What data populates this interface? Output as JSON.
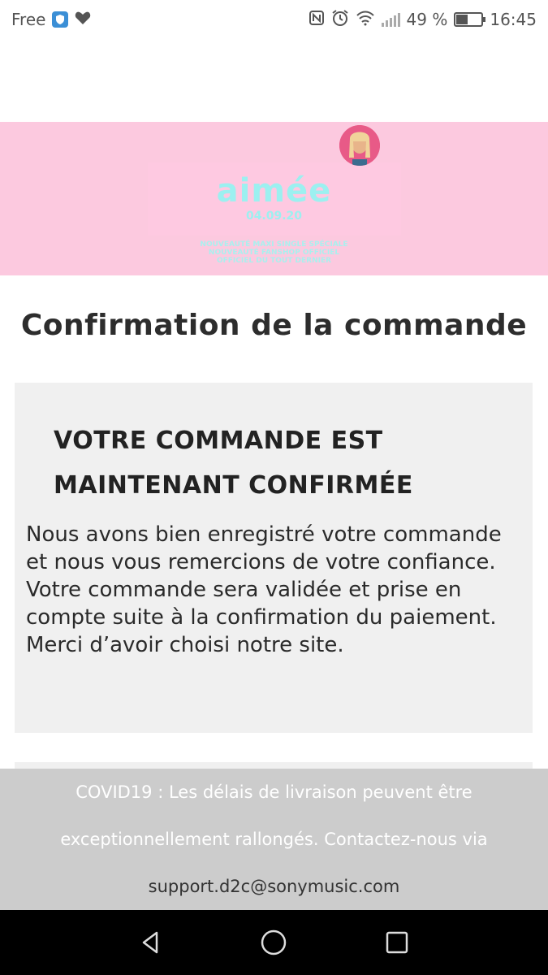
{
  "status_bar": {
    "carrier": "Free",
    "battery_text": "49 %",
    "time": "16:45"
  },
  "banner": {
    "logo_word": "aimée",
    "logo_date": "04.09.20",
    "logo_lines": [
      "NOUVEAUTÉ MAXI SINGLE SPÉCIALE",
      "NOUVEAUTÉ FANSHOP OFFICIEL",
      "OFFICIEL DU TOUT DERNIER"
    ]
  },
  "page": {
    "title": "Confirmation de la commande"
  },
  "confirmation": {
    "heading": "VOTRE COMMANDE EST MAINTENANT CONFIRMÉE",
    "message_line1": "Nous avons bien enregistré votre commande et nous vous remercions de votre confiance.",
    "message_line2": "Votre commande sera validée et prise en compte suite à la confirmation du paiement. Merci d’avoir choisi notre site."
  },
  "notice": {
    "line1": "COVID19 : Les délais de livraison peuvent être",
    "line2": "exceptionnellement rallongés. Contactez-nous via",
    "email": "support.d2c@sonymusic.com"
  },
  "colors": {
    "banner_bg": "#fcc9df",
    "logo_text": "#9cf0f0",
    "card_bg": "#f0f0f0",
    "notice_bg": "#cccccc"
  },
  "icons": [
    "shield-icon",
    "heart-icon",
    "nfc-icon",
    "alarm-icon",
    "wifi-icon",
    "signal-icon",
    "battery-icon",
    "back-icon",
    "home-icon",
    "recents-icon"
  ]
}
